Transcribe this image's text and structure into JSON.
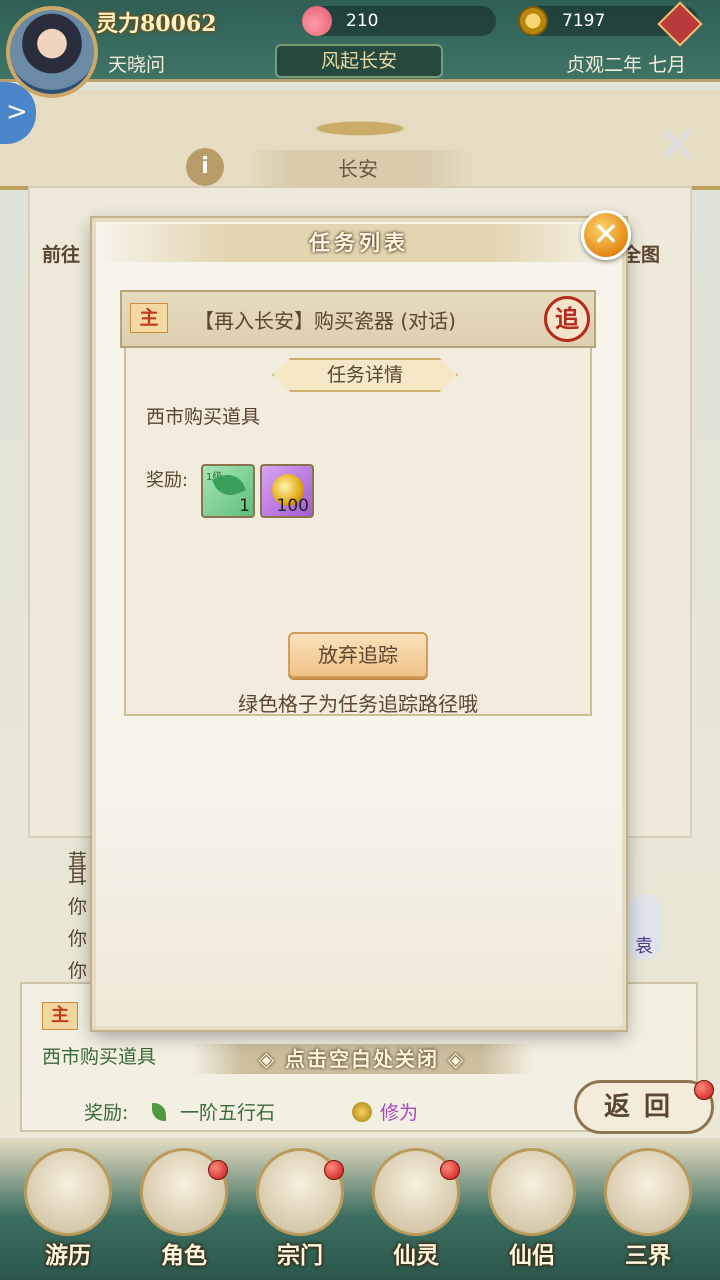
{
  "top": {
    "spirit_power": "灵力80062",
    "peach_count": "210",
    "coin_count": "7197",
    "player_name": "天晓问",
    "chapter_title": "风起长安",
    "game_date": "贞观二年 七月"
  },
  "map": {
    "city": "长安",
    "left_goto": "前往",
    "right_map": "全图",
    "left_arrow": ">",
    "close": "✕",
    "info": "i"
  },
  "background_text": {
    "lines": [
      "茸",
      "耳",
      "你",
      "你",
      "你"
    ],
    "side_badge": "袁"
  },
  "bottom_quest": {
    "tag": "主",
    "desc": "西市购买道具",
    "close_hint": "◈ 点击空白处关闭 ◈",
    "reward_label": "奖励:",
    "reward1": "一阶五行石",
    "reward2": "修为"
  },
  "return_button": "返回",
  "nav": [
    {
      "label": "游历"
    },
    {
      "label": "角色"
    },
    {
      "label": "宗门"
    },
    {
      "label": "仙灵"
    },
    {
      "label": "仙侣"
    },
    {
      "label": "三界"
    }
  ],
  "dialog": {
    "title": "任务列表",
    "close": "✕",
    "quest_tag": "主",
    "quest_name": "【再入长安】购买瓷器 (对话)",
    "track_seal": "追",
    "detail_header": "任务详情",
    "detail_desc": "西市购买道具",
    "reward_label": "奖励:",
    "rewards": [
      {
        "name": "一阶五行石",
        "tag": "1级",
        "count": "1",
        "color": "#5fbf7c"
      },
      {
        "name": "修为",
        "count": "100",
        "color": "#a45ad3"
      }
    ],
    "abandon_button": "放弃追踪",
    "hint": "绿色格子为任务追踪路径哦"
  }
}
